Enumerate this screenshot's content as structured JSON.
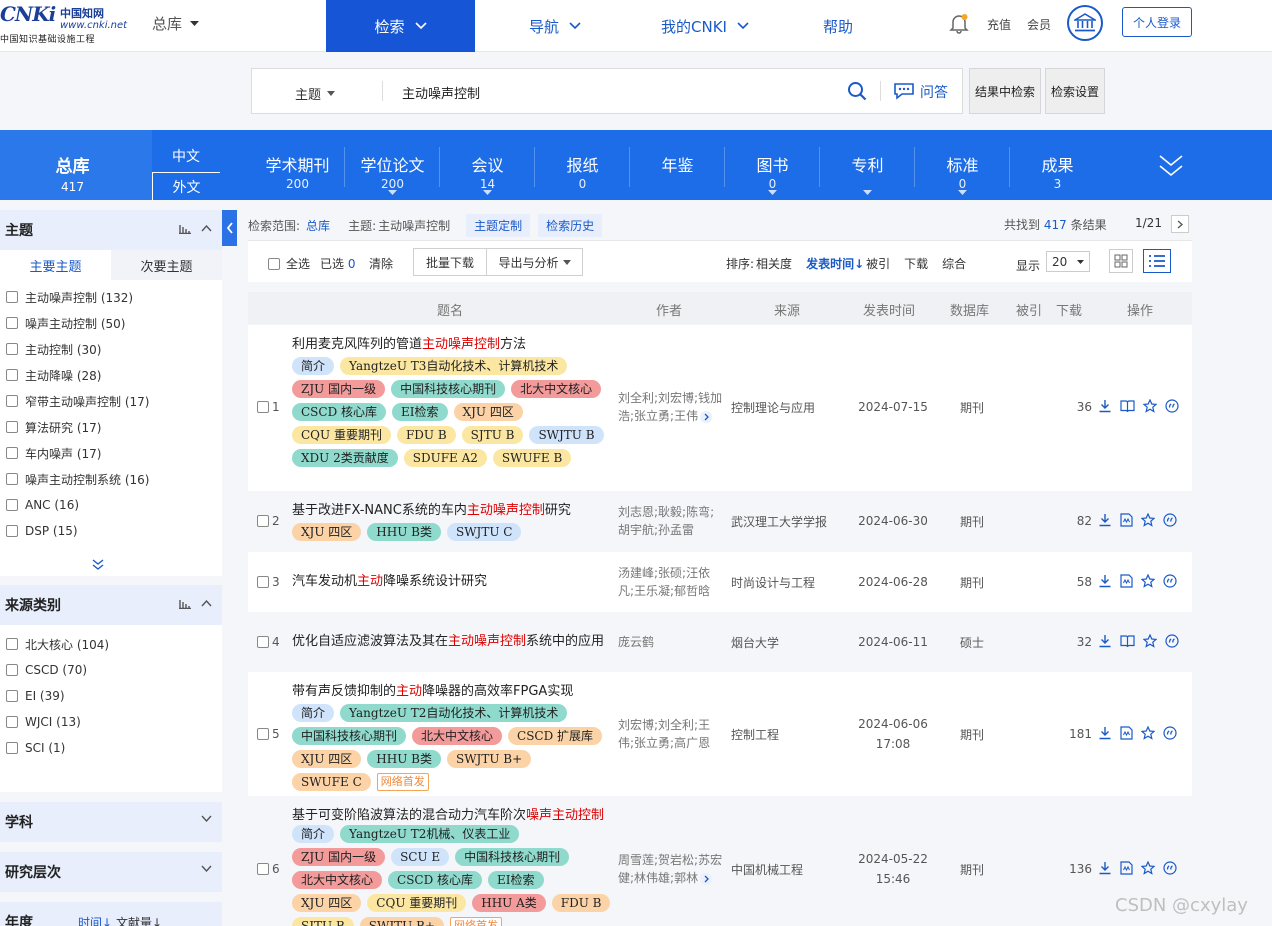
{
  "header": {
    "logo_brand": "CNKi",
    "logo_cn": "中国知网",
    "logo_url": "www.cnki.net",
    "logo_sub": "中国知识基础设施工程",
    "library": "总库",
    "nav": {
      "search": "检索",
      "guide": "导航",
      "mycnki": "我的CNKI",
      "help": "帮助"
    },
    "recharge": "充值",
    "member": "会员",
    "login": "个人登录"
  },
  "search": {
    "field": "主题",
    "query": "主动噪声控制",
    "qa": "问答",
    "in_result": "结果中检索",
    "settings": "检索设置"
  },
  "db_bar": {
    "all_label": "总库",
    "all_count": "417",
    "lang_zh": "中文",
    "lang_en": "外文",
    "items": [
      {
        "label": "学术期刊",
        "count": "200",
        "arrow": false
      },
      {
        "label": "学位论文",
        "count": "200",
        "arrow": true
      },
      {
        "label": "会议",
        "count": "14",
        "arrow": true
      },
      {
        "label": "报纸",
        "count": "0",
        "arrow": false
      },
      {
        "label": "年鉴",
        "count": "",
        "arrow": false
      },
      {
        "label": "图书",
        "count": "0",
        "arrow": true
      },
      {
        "label": "专利",
        "count": "",
        "arrow": true
      },
      {
        "label": "标准",
        "count": "0",
        "arrow": true
      },
      {
        "label": "成果",
        "count": "3",
        "arrow": false
      }
    ]
  },
  "sidebar": {
    "topic_title": "主题",
    "tab_major": "主要主题",
    "tab_minor": "次要主题",
    "topics": [
      "主动噪声控制 (132)",
      "噪声主动控制 (50)",
      "主动控制 (30)",
      "主动降噪 (28)",
      "窄带主动噪声控制 (17)",
      "算法研究 (17)",
      "车内噪声 (17)",
      "噪声主动控制系统 (16)",
      "ANC (16)",
      "DSP (15)"
    ],
    "source_title": "来源类别",
    "sources": [
      "北大核心 (104)",
      "CSCD (70)",
      "EI (39)",
      "WJCI (13)",
      "SCI (1)"
    ],
    "subject_title": "学科",
    "level_title": "研究层次",
    "year_title": "年度",
    "year_sort_time": "时间↓",
    "year_sort_count": "文献量↓"
  },
  "results": {
    "scope_label": "检索范围:",
    "scope_value": "总库",
    "topic_label": "主题:",
    "topic_value": "主动噪声控制",
    "topic_custom": "主题定制",
    "history": "检索历史",
    "found_prefix": "共找到",
    "found_count": "417",
    "found_suffix": "条结果",
    "page": "1/21",
    "select_all": "全选",
    "selected_label": "已选",
    "selected_count": "0",
    "clear": "清除",
    "batch_download": "批量下载",
    "export": "导出与分析",
    "sort_label": "排序:",
    "sort_relevance": "相关度",
    "sort_time": "发表时间",
    "sort_cited": "被引",
    "sort_download": "下载",
    "sort_overall": "综合",
    "display_label": "显示",
    "display_value": "20",
    "columns": {
      "title": "题名",
      "author": "作者",
      "source": "来源",
      "date": "发表时间",
      "db": "数据库",
      "cited": "被引",
      "download": "下载",
      "ops": "操作"
    },
    "rows": [
      {
        "num": "1",
        "title_pre": "利用麦克风阵列的管道",
        "title_hl": "主动噪声控制",
        "title_post": "方法",
        "author": "刘全利;刘宏博;钱加浩;张立勇;王伟",
        "source": "控制理论与应用",
        "date": "2024-07-15",
        "db": "期刊",
        "cited": "",
        "downloads": "36"
      },
      {
        "num": "2",
        "title_pre": "基于改进FX-NANC系统的车内",
        "title_hl": "主动噪声控制",
        "title_post": "研究",
        "author": "刘志恩;耿毅;陈弯;胡宇航;孙孟雷",
        "source": "武汉理工大学学报",
        "date": "2024-06-30",
        "db": "期刊",
        "cited": "",
        "downloads": "82"
      },
      {
        "num": "3",
        "title_pre": "汽车发动机",
        "title_hl": "主动",
        "title_post": "降噪系统设计研究",
        "author": "汤建峰;张硕;汪依凡;王乐凝;郁哲晗",
        "source": "时尚设计与工程",
        "date": "2024-06-28",
        "db": "期刊",
        "cited": "",
        "downloads": "58"
      },
      {
        "num": "4",
        "title_pre": "优化自适应滤波算法及其在",
        "title_hl": "主动噪声控制",
        "title_post": "系统中的应用",
        "author": "庞云鹤",
        "source": "烟台大学",
        "date": "2024-06-11",
        "db": "硕士",
        "cited": "",
        "downloads": "32"
      },
      {
        "num": "5",
        "title_pre": "带有声反馈抑制的",
        "title_hl": "主动",
        "title_post": "降噪器的高效率FPGA实现",
        "author": "刘宏博;刘全利;王伟;张立勇;高广恩",
        "source": "控制工程",
        "date": "2024-06-06 17:08",
        "db": "期刊",
        "cited": "",
        "downloads": "181"
      },
      {
        "num": "6",
        "title_pre": "基于可变阶陷波算法的混合动力汽车阶次",
        "title_hl": "噪声主动控制",
        "title_post": "",
        "author": "周雪莲;贺岩松;苏宏健;林伟雄;郭林",
        "source": "中国机械工程",
        "date": "2024-05-22 15:46",
        "db": "期刊",
        "cited": "",
        "downloads": "136"
      }
    ],
    "tags": {
      "r1": [
        "简介",
        "YangtzeU T3自动化技术、计算机技术",
        "ZJU 国内一级",
        "中国科技核心期刊",
        "北大中文核心",
        "CSCD 核心库",
        "EI检索",
        "XJU 四区",
        "CQU 重要期刊",
        "FDU B",
        "SJTU B",
        "SWJTU B",
        "XDU 2类贡献度",
        "SDUFE A2",
        "SWUFE B"
      ],
      "r2": [
        "XJU 四区",
        "HHU B类",
        "SWJTU C"
      ],
      "r5": [
        "简介",
        "YangtzeU T2自动化技术、计算机技术",
        "中国科技核心期刊",
        "北大中文核心",
        "CSCD 扩展库",
        "XJU 四区",
        "HHU B类",
        "SWJTU B+",
        "SWUFE C",
        "网络首发"
      ],
      "r6": [
        "简介",
        "YangtzeU T2机械、仪表工业",
        "ZJU 国内一级",
        "SCU E",
        "中国科技核心期刊",
        "北大中文核心",
        "CSCD 核心库",
        "EI检索",
        "XJU 四区",
        "CQU 重要期刊",
        "HHU A类",
        "FDU B",
        "SJTU B",
        "SWJTU B+",
        "网络首发"
      ]
    },
    "tag_colors": {
      "r1": [
        "blue",
        "yellow",
        "red",
        "teal",
        "red",
        "teal",
        "teal",
        "orange",
        "yellow",
        "yellow",
        "yellow",
        "blue",
        "teal",
        "yellow",
        "yellow"
      ],
      "r2": [
        "orange",
        "teal",
        "blue"
      ],
      "r5": [
        "blue",
        "teal",
        "teal",
        "red",
        "orange",
        "orange",
        "teal",
        "orange",
        "orange",
        "net"
      ],
      "r6": [
        "blue",
        "teal",
        "red",
        "blue",
        "teal",
        "red",
        "teal",
        "teal",
        "orange",
        "yellow",
        "red",
        "orange",
        "yellow",
        "orange",
        "net"
      ]
    }
  },
  "watermark": "CSDN @cxylay",
  "colors": {
    "accent": "#1656d6",
    "dbbar": "#1d6ce8",
    "highlight": "#dd0000"
  }
}
